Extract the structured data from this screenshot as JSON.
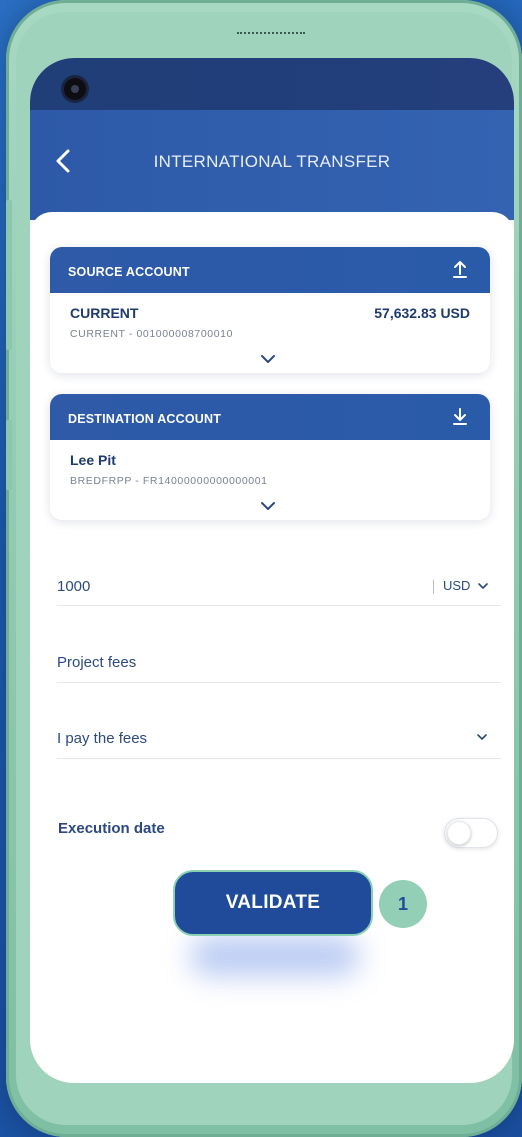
{
  "app": {
    "title": "INTERNATIONAL TRANSFER",
    "colors": {
      "primary": "#2d59a8",
      "accent": "#8fc9b0",
      "text": "#1e3a6e"
    }
  },
  "source": {
    "header": "SOURCE ACCOUNT",
    "name": "CURRENT",
    "sub": "CURRENT - 001000008700010",
    "balance": "57,632.83 USD",
    "icon": "upload-icon"
  },
  "destination": {
    "header": "DESTINATION ACCOUNT",
    "name": "Lee Pit",
    "sub": "BREDFRPP - FR14000000000000001",
    "icon": "download-icon"
  },
  "form": {
    "amount": "1000",
    "currency": "USD",
    "reference": "Project fees",
    "fees": "I pay the fees",
    "execution_label": "Execution date",
    "execution_enabled": false
  },
  "actions": {
    "validate": "VALIDATE",
    "step": "1"
  }
}
